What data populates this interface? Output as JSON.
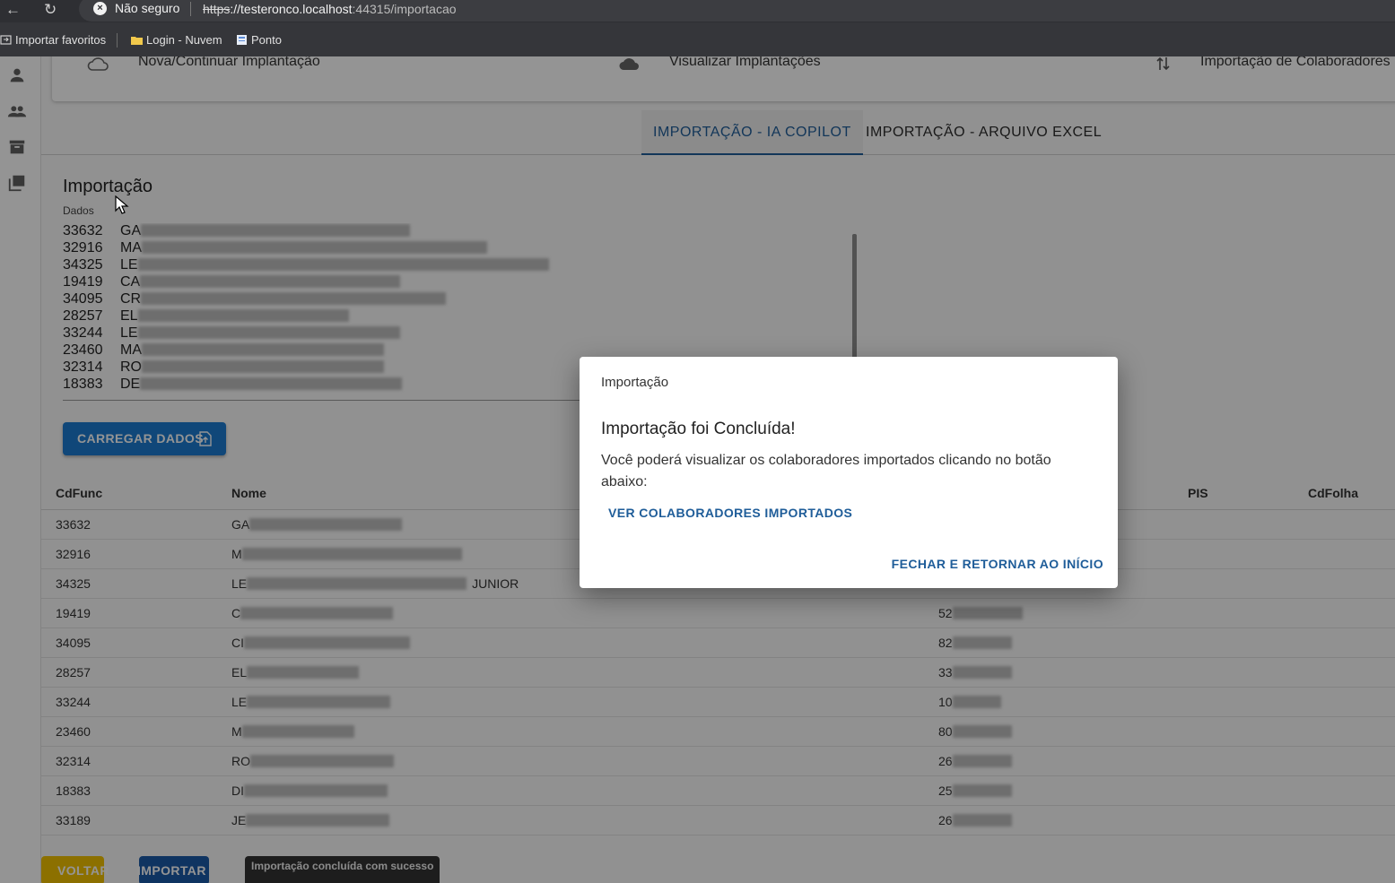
{
  "browser": {
    "security_label": "Não seguro",
    "url_scheme": "https",
    "url_host": "://testeronco.localhost",
    "url_rest": ":44315/importacao",
    "bookmarks": [
      {
        "label": "Importar favoritos",
        "icon": "import-icon"
      },
      {
        "label": "Login - Nuvem",
        "icon": "folder-icon"
      },
      {
        "label": "Ponto",
        "icon": "page-icon"
      }
    ]
  },
  "topnav": {
    "items": [
      {
        "label": "Nova/Continuar Implantação",
        "icon": "cloud-outline-icon"
      },
      {
        "label": "Visualizar Implantações",
        "icon": "cloud-filled-icon"
      },
      {
        "label": "Importação de Colaboradores",
        "icon": "sort-arrows-icon"
      }
    ]
  },
  "sidebar": {
    "icons": [
      "person-icon",
      "group-icon",
      "archive-icon",
      "library-icon"
    ]
  },
  "tabs": [
    {
      "label": "IMPORTAÇÃO - IA COPILOT",
      "active": true
    },
    {
      "label": "IMPORTAÇÃO - ARQUIVO EXCEL",
      "active": false
    }
  ],
  "import_section": {
    "title": "Importação",
    "field_label": "Dados",
    "lines": [
      {
        "code": "33632",
        "initial": "GA"
      },
      {
        "code": "32916",
        "initial": "MA"
      },
      {
        "code": "34325",
        "initial": "LE"
      },
      {
        "code": "19419",
        "initial": "CA"
      },
      {
        "code": "34095",
        "initial": "CR"
      },
      {
        "code": "28257",
        "initial": "EL"
      },
      {
        "code": "33244",
        "initial": "LE"
      },
      {
        "code": "23460",
        "initial": "MA"
      },
      {
        "code": "32314",
        "initial": "RO"
      },
      {
        "code": "18383",
        "initial": "DE"
      }
    ],
    "load_button": "CARREGAR DADOS"
  },
  "table": {
    "headers": {
      "cdfunc": "CdFunc",
      "nome": "Nome",
      "pis": "PIS",
      "cdfolha": "CdFolha"
    },
    "rows": [
      {
        "cdfunc": "33632",
        "nome": "GA",
        "nome_suffix": "",
        "num": ""
      },
      {
        "cdfunc": "32916",
        "nome": "M",
        "nome_suffix": "",
        "num": ""
      },
      {
        "cdfunc": "34325",
        "nome": "LE",
        "nome_suffix": "JUNIOR",
        "num": ""
      },
      {
        "cdfunc": "19419",
        "nome": "C",
        "nome_suffix": "",
        "num": "52"
      },
      {
        "cdfunc": "34095",
        "nome": "CI",
        "nome_suffix": "",
        "num": "82"
      },
      {
        "cdfunc": "28257",
        "nome": "EL",
        "nome_suffix": "",
        "num": "33"
      },
      {
        "cdfunc": "33244",
        "nome": "LE",
        "nome_suffix": "",
        "num": "10"
      },
      {
        "cdfunc": "23460",
        "nome": "M",
        "nome_suffix": "",
        "num": "80"
      },
      {
        "cdfunc": "32314",
        "nome": "RO",
        "nome_suffix": "",
        "num": "26"
      },
      {
        "cdfunc": "18383",
        "nome": "DI",
        "nome_suffix": "",
        "num": "25"
      },
      {
        "cdfunc": "33189",
        "nome": "JE",
        "nome_suffix": "",
        "num": "26"
      }
    ]
  },
  "footer": {
    "back_button": "VOLTAR",
    "import_button": "IMPORTAR",
    "toast": "Importação concluída com sucesso"
  },
  "dialog": {
    "title": "Importação",
    "heading": "Importação foi Concluída!",
    "message": "Você poderá visualizar os colaboradores importados clicando no botão abaixo:",
    "view_button": "VER COLABORADORES IMPORTADOS",
    "close_button": "FECHAR E RETORNAR AO INÍCIO"
  },
  "colors": {
    "primary": "#1f5d99",
    "load_button": "#1c7bd1",
    "back_button": "#f2c200",
    "import_button": "#1a5aa8",
    "toast": "#323232"
  }
}
